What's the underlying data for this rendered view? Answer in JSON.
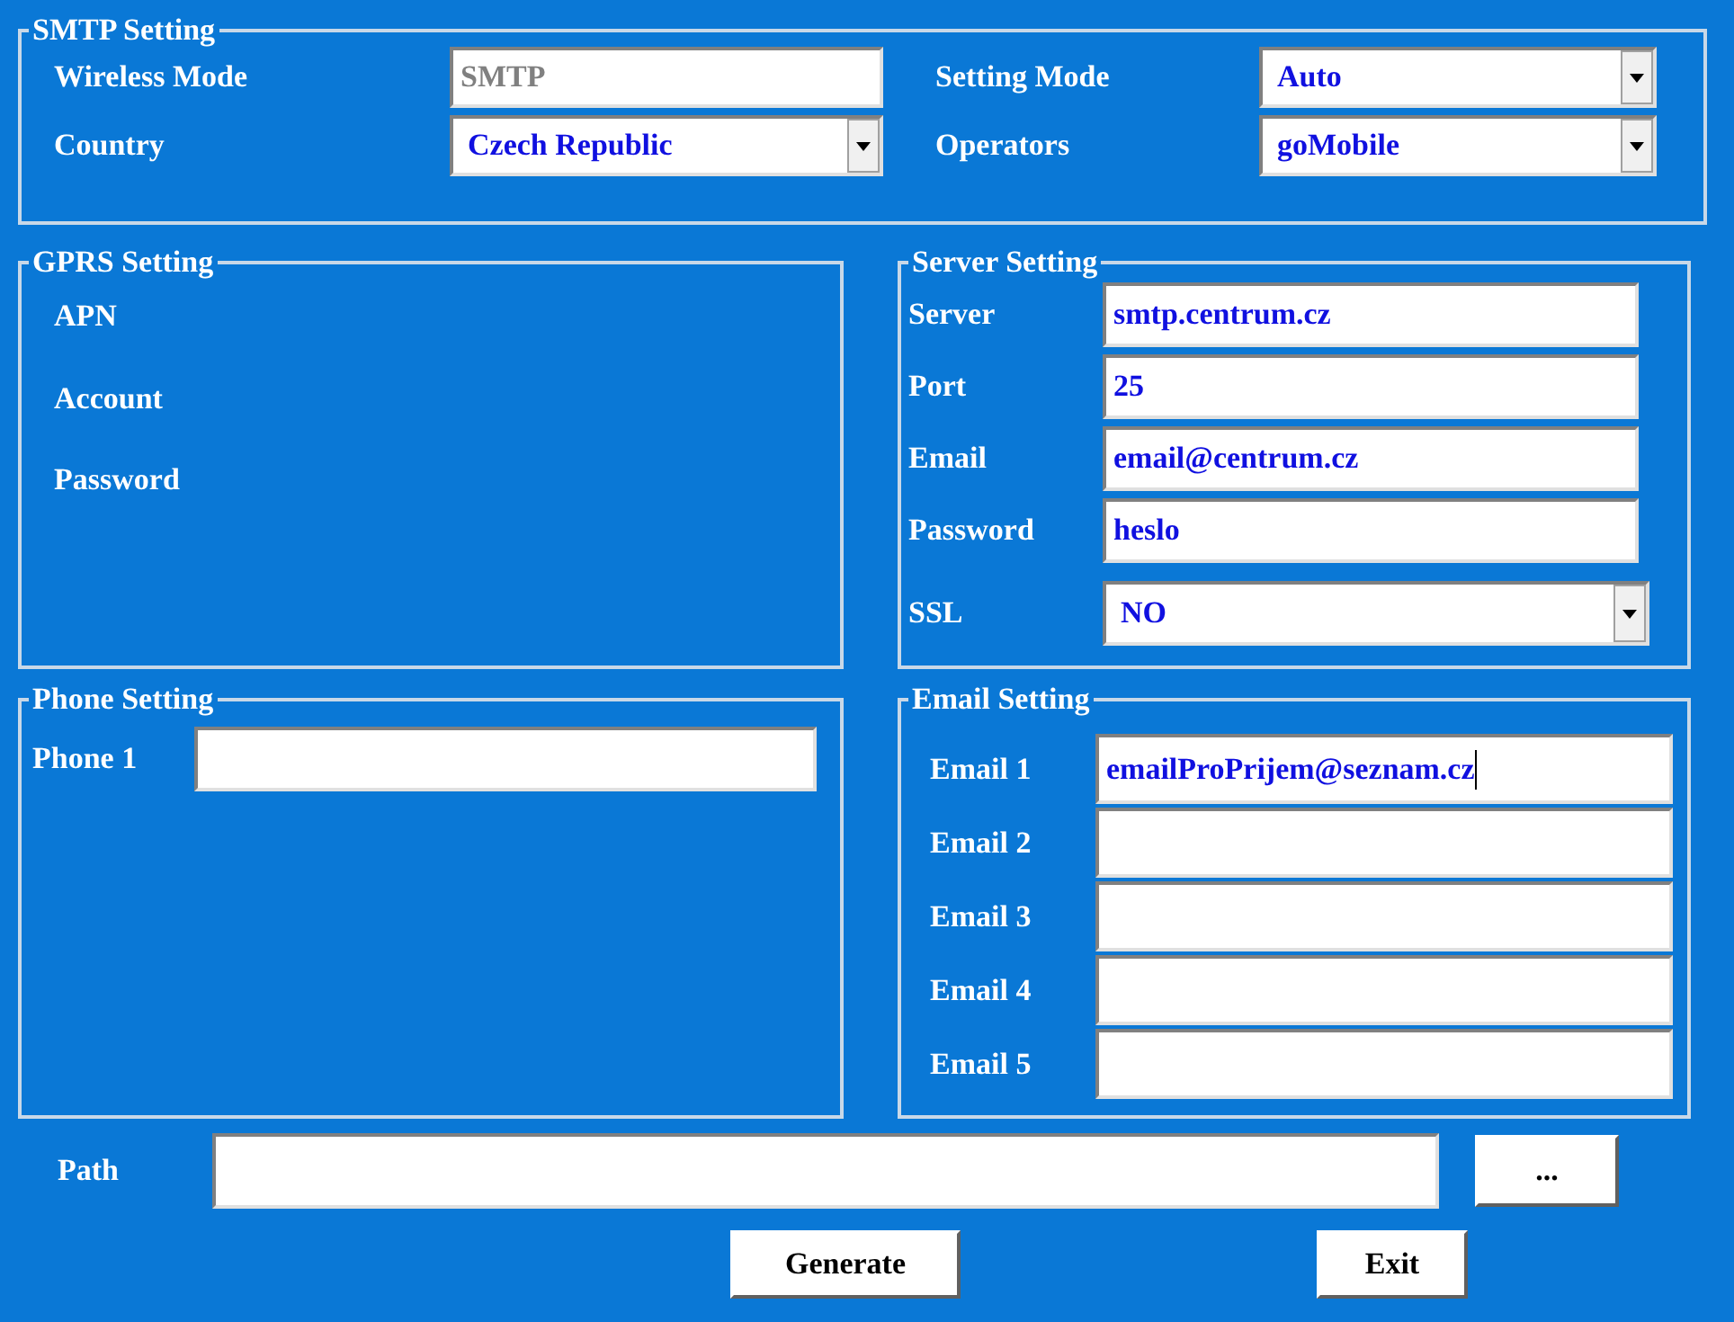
{
  "smtp_setting": {
    "title": "SMTP Setting",
    "fields": [
      {
        "label": "Wireless Mode",
        "kind": "text",
        "value": "SMTP",
        "disabled": true
      },
      {
        "label": "Setting Mode",
        "kind": "select",
        "value": "Auto",
        "disabled": false
      },
      {
        "label": "Country",
        "kind": "select",
        "value": "Czech Republic",
        "disabled": false
      },
      {
        "label": "Operators",
        "kind": "select",
        "value": "goMobile",
        "disabled": false
      }
    ]
  },
  "gprs_setting": {
    "title": "GPRS Setting",
    "labels": [
      "APN",
      "Account",
      "Password"
    ]
  },
  "server_setting": {
    "title": "Server Setting",
    "fields": [
      {
        "label": "Server",
        "kind": "text",
        "value": "smtp.centrum.cz"
      },
      {
        "label": "Port",
        "kind": "text",
        "value": "25"
      },
      {
        "label": "Email",
        "kind": "text",
        "value": "email@centrum.cz"
      },
      {
        "label": "Password",
        "kind": "text",
        "value": "heslo"
      },
      {
        "label": "SSL",
        "kind": "select",
        "value": "NO"
      }
    ]
  },
  "phone_setting": {
    "title": "Phone Setting",
    "fields": [
      {
        "label": "Phone 1"
      }
    ]
  },
  "email_setting": {
    "title": "Email Setting",
    "fields": [
      {
        "label": "Email 1",
        "value": "emailProPrijem@seznam.cz",
        "focused": true
      },
      {
        "label": "Email 2",
        "focused": false
      },
      {
        "label": "Email 3",
        "focused": false
      },
      {
        "label": "Email 4",
        "focused": false
      },
      {
        "label": "Email 5",
        "focused": false
      }
    ]
  },
  "path": {
    "label": "Path",
    "browse_button": "..."
  },
  "buttons": [
    "Generate",
    "Exit"
  ]
}
